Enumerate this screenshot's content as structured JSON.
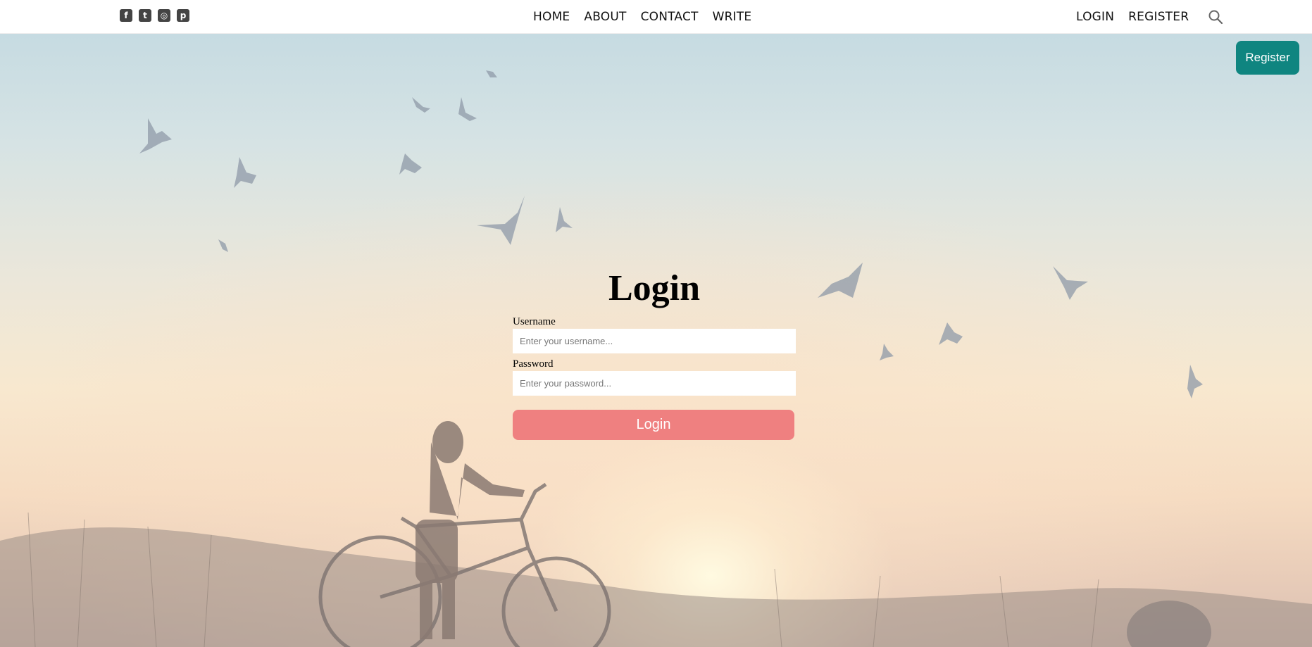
{
  "topbar": {
    "social_icons": [
      "facebook-icon",
      "twitter-icon",
      "instagram-icon",
      "pinterest-icon"
    ],
    "nav": [
      "HOME",
      "ABOUT",
      "CONTACT",
      "WRITE"
    ],
    "auth": {
      "login": "LOGIN",
      "register": "REGISTER"
    },
    "search_icon": "search-icon"
  },
  "floating_register": "Register",
  "login_form": {
    "title": "Login",
    "username_label": "Username",
    "username_placeholder": "Enter your username...",
    "password_label": "Password",
    "password_placeholder": "Enter your password...",
    "submit": "Login"
  },
  "colors": {
    "register_button": "#0f8580",
    "login_button": "#ef8080"
  }
}
